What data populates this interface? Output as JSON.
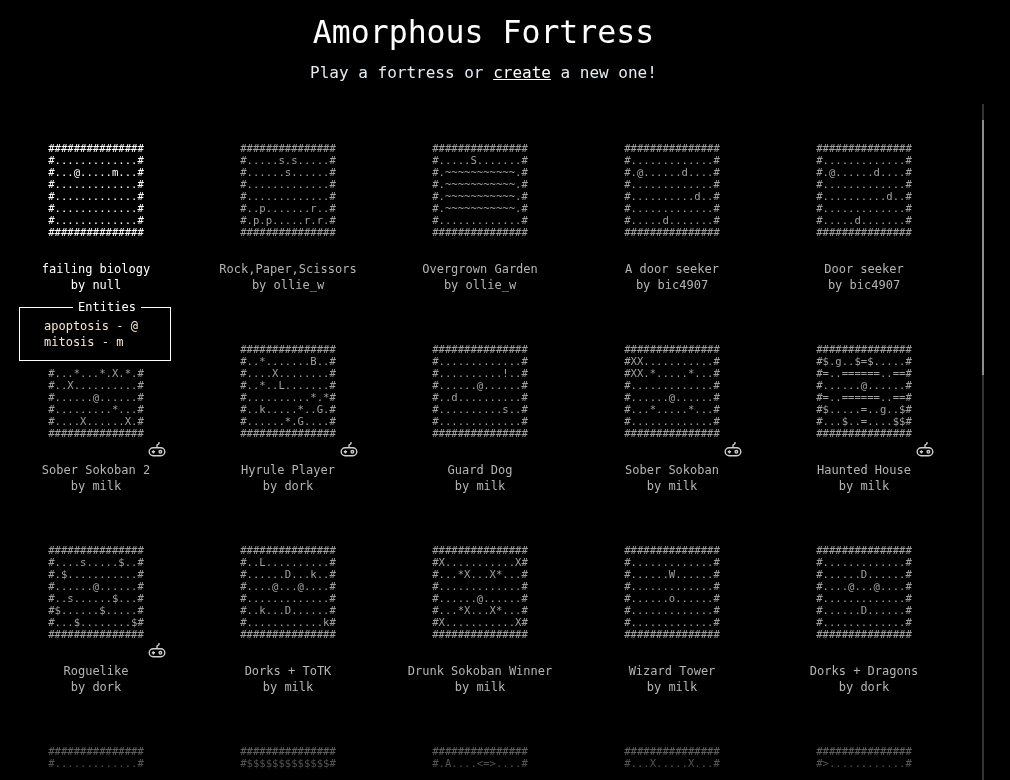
{
  "header": {
    "title": "Amorphous Fortress",
    "subtitle": {
      "lead": "Play a fortress or",
      "link": "create",
      "tail": "a new one!"
    }
  },
  "fortresses": [
    {
      "title": "failing biology",
      "byline": "by null",
      "hovered": true,
      "gamepad": false,
      "map": [
        "###############",
        "#.............#",
        "#...@.....m...#",
        "#.............#",
        "#.............#",
        "#.............#",
        "#.............#",
        "###############"
      ],
      "entities": {
        "title": "Entities",
        "items": [
          "apoptosis - @",
          "mitosis - m"
        ]
      }
    },
    {
      "title": "Rock,Paper,Scissors",
      "byline": "by ollie_w",
      "hovered": false,
      "gamepad": false,
      "map": [
        "###############",
        "#.....s.s.....#",
        "#......s......#",
        "#.............#",
        "#.............#",
        "#..p.......r..#",
        "#.p.p.....r.r.#",
        "###############"
      ]
    },
    {
      "title": "Overgrown Garden",
      "byline": "by ollie_w",
      "hovered": false,
      "gamepad": false,
      "map": [
        "###############",
        "#.....S.......#",
        "#.~~~~~~~~~~~.#",
        "#.~~~~~~~~~~~.#",
        "#.~~~~~~~~~~~.#",
        "#.~~~~~~~~~~~.#",
        "#.............#",
        "###############"
      ]
    },
    {
      "title": "A door seeker",
      "byline": "by bic4907",
      "hovered": false,
      "gamepad": false,
      "map": [
        "###############",
        "#.............#",
        "#.@......d....#",
        "#.............#",
        "#..........d..#",
        "#.............#",
        "#.....d.......#",
        "###############"
      ]
    },
    {
      "title": "Door seeker",
      "byline": "by bic4907",
      "hovered": false,
      "gamepad": false,
      "map": [
        "###############",
        "#.............#",
        "#.@......d....#",
        "#.............#",
        "#..........d..#",
        "#.............#",
        "#.....d.......#",
        "###############"
      ]
    },
    {
      "title": "Sober Sokoban 2",
      "byline": "by milk",
      "hovered": false,
      "gamepad": true,
      "map": [
        "#...*...*.X.*.#",
        "#..X..........#",
        "#......@......#",
        "#.........*...#",
        "#....X......X.#",
        "###############"
      ]
    },
    {
      "title": "Hyrule Player",
      "byline": "by dork",
      "hovered": false,
      "gamepad": true,
      "map": [
        "###############",
        "#..*.......B..#",
        "#....X........#",
        "#..*..L.......#",
        "#..........*.*#",
        "#..k.....*..G.#",
        "#......*.G....#",
        "###############"
      ]
    },
    {
      "title": "Guard Dog",
      "byline": "by milk",
      "hovered": false,
      "gamepad": false,
      "map": [
        "###############",
        "#.............#",
        "#..........!..#",
        "#......@......#",
        "#..d..........#",
        "#..........s..#",
        "#.............#",
        "###############"
      ]
    },
    {
      "title": "Sober Sokoban",
      "byline": "by milk",
      "hovered": false,
      "gamepad": true,
      "map": [
        "###############",
        "#XX...........#",
        "#XX.*.....*...#",
        "#.............#",
        "#......@......#",
        "#...*.....*...#",
        "#.............#",
        "###############"
      ]
    },
    {
      "title": "Haunted House",
      "byline": "by milk",
      "hovered": false,
      "gamepad": true,
      "map": [
        "###############",
        "#$.g..$=$.....#",
        "#=..======..==#",
        "#......@......#",
        "#=..======..==#",
        "#$.....=..g..$#",
        "#...$..=....$$#",
        "###############"
      ]
    },
    {
      "title": "Roguelike",
      "byline": "by dork",
      "hovered": false,
      "gamepad": true,
      "map": [
        "###############",
        "#....s.....$..#",
        "#.$...........#",
        "#......@......#",
        "#..s......$...#",
        "#$......$.....#",
        "#...$........$#",
        "###############"
      ]
    },
    {
      "title": "Dorks + ToTK",
      "byline": "by milk",
      "hovered": false,
      "gamepad": false,
      "map": [
        "###############",
        "#..L..........#",
        "#......D...k..#",
        "#....@...@....#",
        "#.............#",
        "#..k...D......#",
        "#............k#",
        "###############"
      ]
    },
    {
      "title": "Drunk Sokoban Winner",
      "byline": "by milk",
      "hovered": false,
      "gamepad": false,
      "map": [
        "###############",
        "#X...........X#",
        "#...*X...X*...#",
        "#.............#",
        "#......@......#",
        "#...*X...X*...#",
        "#X...........X#",
        "###############"
      ]
    },
    {
      "title": "Wizard Tower",
      "byline": "by milk",
      "hovered": false,
      "gamepad": false,
      "map": [
        "###############",
        "#.............#",
        "#......W......#",
        "#.............#",
        "#......o......#",
        "#.............#",
        "#.............#",
        "###############"
      ]
    },
    {
      "title": "Dorks + Dragons",
      "byline": "by dork",
      "hovered": false,
      "gamepad": false,
      "map": [
        "###############",
        "#.............#",
        "#......D......#",
        "#....@...@....#",
        "#.............#",
        "#......D......#",
        "#.............#",
        "###############"
      ]
    },
    {
      "hovered": false,
      "map": [
        "###############",
        "#.............#"
      ]
    },
    {
      "hovered": false,
      "map": [
        "###############",
        "#$$$$$$$$$$$$$#"
      ]
    },
    {
      "hovered": false,
      "map": [
        "###############",
        "#.A....<=>....#"
      ]
    },
    {
      "hovered": false,
      "map": [
        "###############",
        "#...X.....X...#"
      ]
    },
    {
      "hovered": false,
      "map": [
        "###############",
        "#>............#"
      ]
    }
  ]
}
